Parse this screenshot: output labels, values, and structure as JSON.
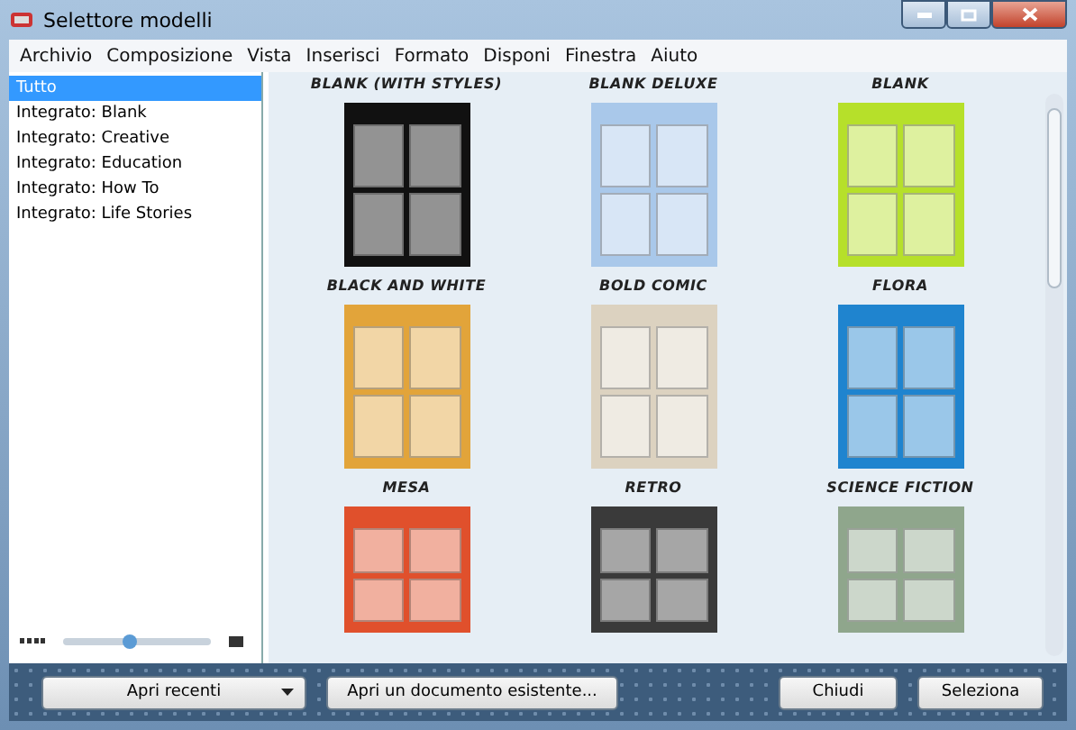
{
  "window": {
    "title": "Selettore modelli"
  },
  "menu": [
    "Archivio",
    "Composizione",
    "Vista",
    "Inserisci",
    "Formato",
    "Disponi",
    "Finestra",
    "Aiuto"
  ],
  "sidebar": {
    "items": [
      {
        "label": "Tutto",
        "selected": true
      },
      {
        "label": "Integrato: Blank",
        "selected": false
      },
      {
        "label": "Integrato: Creative",
        "selected": false
      },
      {
        "label": "Integrato: Education",
        "selected": false
      },
      {
        "label": "Integrato: How To",
        "selected": false
      },
      {
        "label": "Integrato: Life Stories",
        "selected": false
      }
    ],
    "zoom": {
      "level": 0.45
    }
  },
  "templates": [
    {
      "name": "BLANK (WITH STYLES)"
    },
    {
      "name": "BLANK DELUXE"
    },
    {
      "name": "BLANK"
    },
    {
      "name": "BLACK AND WHITE",
      "color": "#111111"
    },
    {
      "name": "BOLD COMIC",
      "color": "#a9c8ea"
    },
    {
      "name": "FLORA",
      "color": "#b6e02a"
    },
    {
      "name": "MESA",
      "color": "#e2a43a"
    },
    {
      "name": "RETRO",
      "color": "#dcd2c0"
    },
    {
      "name": "SCIENCE FICTION",
      "color": "#1f84cf"
    },
    {
      "color": "#e0502c"
    },
    {
      "color": "#3a3a3a"
    },
    {
      "color": "#8fa68c"
    }
  ],
  "buttons": [
    {
      "label": "Apri recenti",
      "kind": "dropdown"
    },
    {
      "label": "Apri un documento esistente...",
      "kind": "plain"
    },
    {
      "label": "Chiudi",
      "kind": "plain"
    },
    {
      "label": "Seleziona",
      "kind": "plain"
    }
  ]
}
